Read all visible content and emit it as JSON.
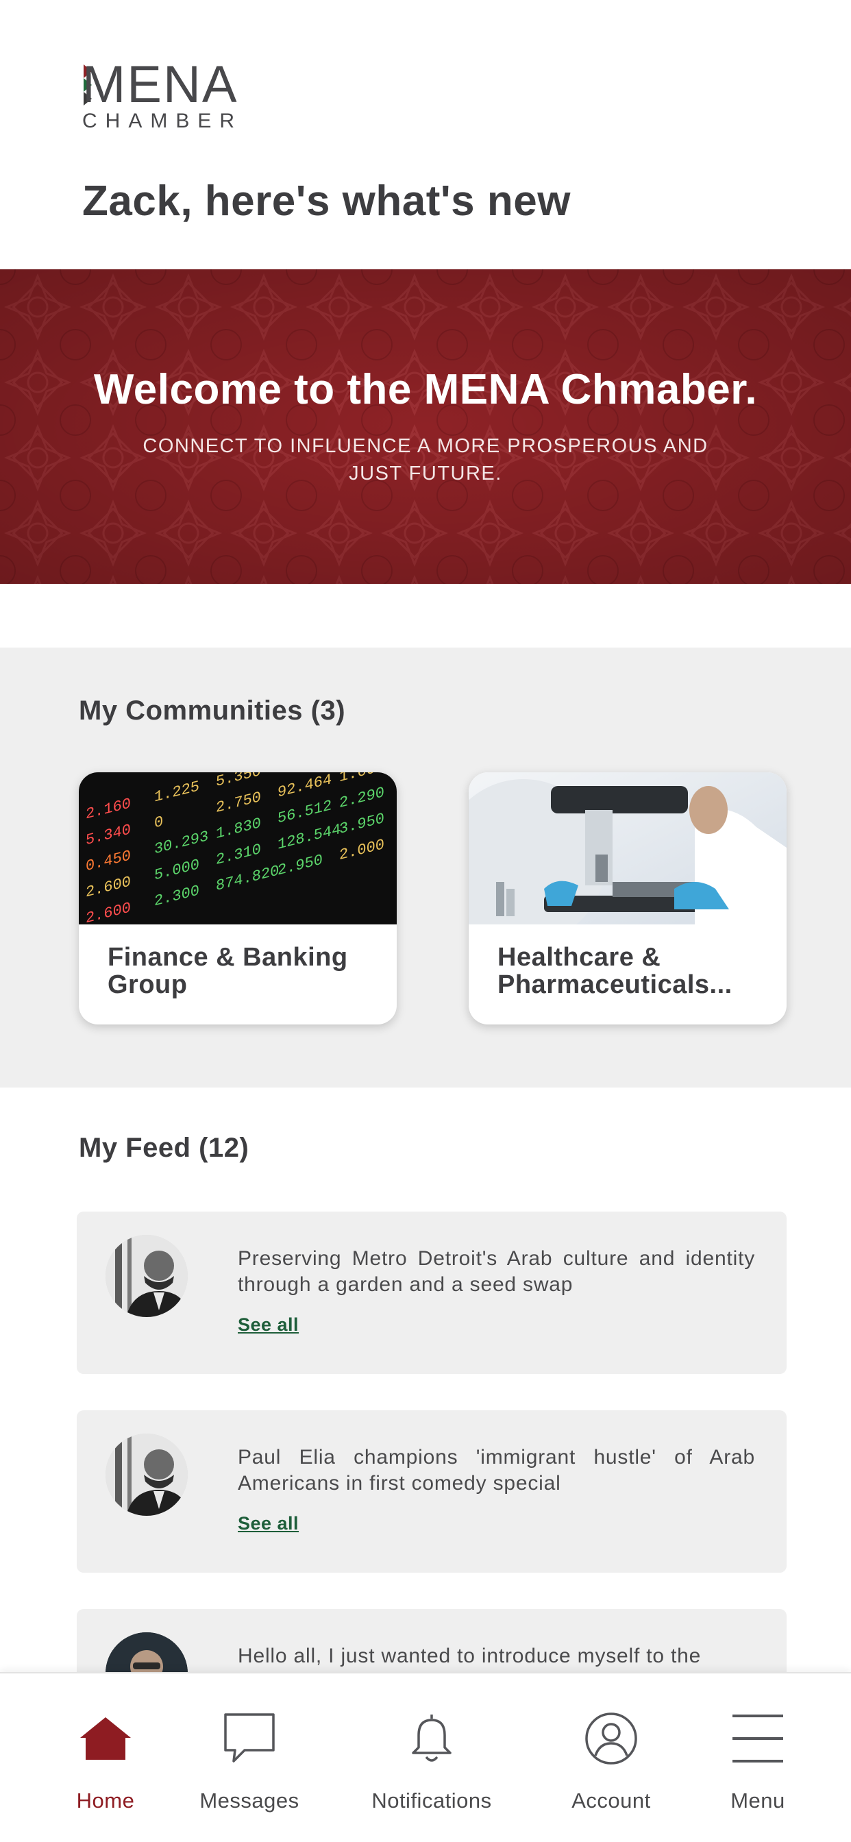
{
  "header": {
    "logo_word": "MENA",
    "logo_sub": "CHAMBER",
    "greeting": "Zack, here's what's new"
  },
  "banner": {
    "title": "Welcome to the MENA Chmaber.",
    "subtitle": "CONNECT TO INFLUENCE A MORE PROSPEROUS AND JUST FUTURE."
  },
  "communities": {
    "title": "My Communities (3)",
    "items": [
      {
        "label": "Finance & Banking Group",
        "image": "stock-ticker-board"
      },
      {
        "label": "Healthcare & Pharmaceuticals...",
        "image": "lab-microscope"
      }
    ]
  },
  "feed": {
    "title": "My Feed (12)",
    "items": [
      {
        "text": "Preserving Metro Detroit's Arab culture and identity through a garden and a seed swap",
        "link": "See all"
      },
      {
        "text": "Paul Elia champions 'immigrant hustle' of Arab Americans in first comedy special",
        "link": "See all"
      },
      {
        "text": "Hello all, I just wanted to introduce myself to the"
      }
    ]
  },
  "tabbar": {
    "items": [
      {
        "label": "Home",
        "icon": "home-icon",
        "active": true
      },
      {
        "label": "Messages",
        "icon": "chat-bubble-icon"
      },
      {
        "label": "Notifications",
        "icon": "bell-icon"
      },
      {
        "label": "Account",
        "icon": "user-circle-icon"
      },
      {
        "label": "Menu",
        "icon": "hamburger-menu-icon"
      }
    ]
  },
  "colors": {
    "brand_red": "#8e2226",
    "active_tab": "#8e1c22",
    "link_green": "#1e5e3a",
    "section_bg": "#efefef"
  }
}
